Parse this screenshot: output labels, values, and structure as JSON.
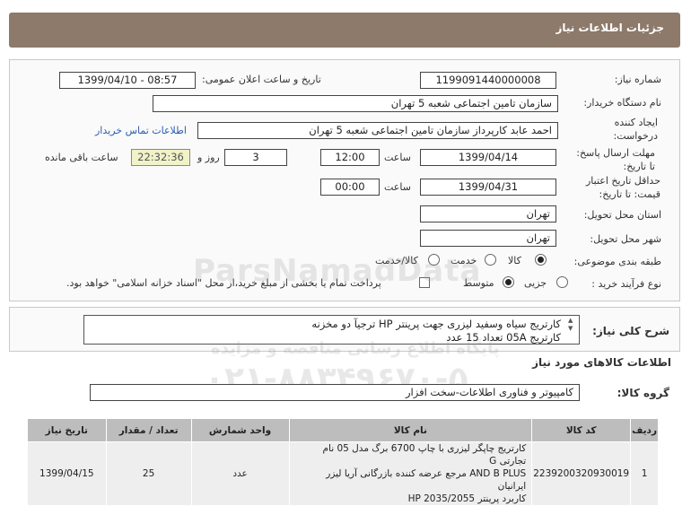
{
  "header": {
    "title": "جزئیات اطلاعات نیاز"
  },
  "form": {
    "need_number_label": "شماره نیاز:",
    "need_number": "1199091440000008",
    "announce_label": "تاریخ و ساعت اعلان عمومی:",
    "announce_value": "1399/04/10 - 08:57",
    "buyer_label": "نام دستگاه خریدار:",
    "buyer_value": "سازمان تامین اجتماعی شعبه 5 تهران",
    "creator_label": "ایجاد کننده درخواست:",
    "creator_value": "احمد عابد کارپرداز سازمان تامین اجتماعی شعبه 5 تهران",
    "contact_link": "اطلاعات تماس خریدار",
    "deadline_label": "مهلت ارسال پاسخ: تا تاریخ:",
    "deadline_date": "1399/04/14",
    "time_label": "ساعت",
    "deadline_time": "12:00",
    "days_value": "3",
    "days_label": "روز و",
    "remaining_time": "22:32:36",
    "remaining_label": "ساعت باقی مانده",
    "validity_label": "حداقل تاریخ اعتبار قیمت: تا تاریخ:",
    "validity_date": "1399/04/31",
    "validity_time": "00:00",
    "province_label": "استان محل تحویل:",
    "province_value": "تهران",
    "city_label": "شهر محل تحویل:",
    "city_value": "تهران",
    "category_label": "طبقه بندی موضوعی:",
    "category_options": [
      "کالا",
      "خدمت",
      "کالا/خدمت"
    ],
    "category_selected": "کالا",
    "process_label": "نوع فرآیند خرید :",
    "process_options": [
      "جزیی",
      "متوسط"
    ],
    "process_selected": "متوسط",
    "payment_note": "پرداخت تمام یا بخشی از مبلغ خرید،از محل \"اسناد خزانه اسلامی\" خواهد بود."
  },
  "description": {
    "label": "شرح کلی نیاز:",
    "line1": "کارتریج سیاه وسفید لیزری جهت پرینتر HP ترجیآ دو مخزنه",
    "line2": "کارتریج 05A تعداد 15 عدد"
  },
  "goods_section": {
    "title": "اطلاعات کالاهای مورد نیاز"
  },
  "goods_group": {
    "label": "گروه کالا:",
    "value": "کامپیوتر و فناوری اطلاعات-سخت افزار"
  },
  "table": {
    "headers": [
      "ردیف",
      "کد کالا",
      "نام کالا",
      "واحد شمارش",
      "تعداد / مقدار",
      "تاریخ نیاز"
    ],
    "rows": [
      {
        "index": "1",
        "code": "2239200320930019",
        "name_line1": "کارتریج چاپگر لیزری با چاپ 6700 برگ مدل 05 نام تجارتی G",
        "name_line2": "AND B PLUS مرجع عرضه کننده بازرگانی آریا لیزر ایرانیان",
        "name_line3": "کاربرد پرینتر HP 2035/2055",
        "unit": "عدد",
        "quantity": "25",
        "date": "1399/04/15"
      }
    ]
  },
  "watermark": {
    "brand": "ParsNamadData",
    "tagline": "پایگاه اطلاع رسانی مناقصه و مزایده",
    "phone": "۰۲۱-۸۸۳۴۹۶۷۰-۵"
  },
  "colors": {
    "header_bg": "#8d7a6a",
    "remaining_bg": "#f2f2c8",
    "link": "#2a5db0"
  }
}
